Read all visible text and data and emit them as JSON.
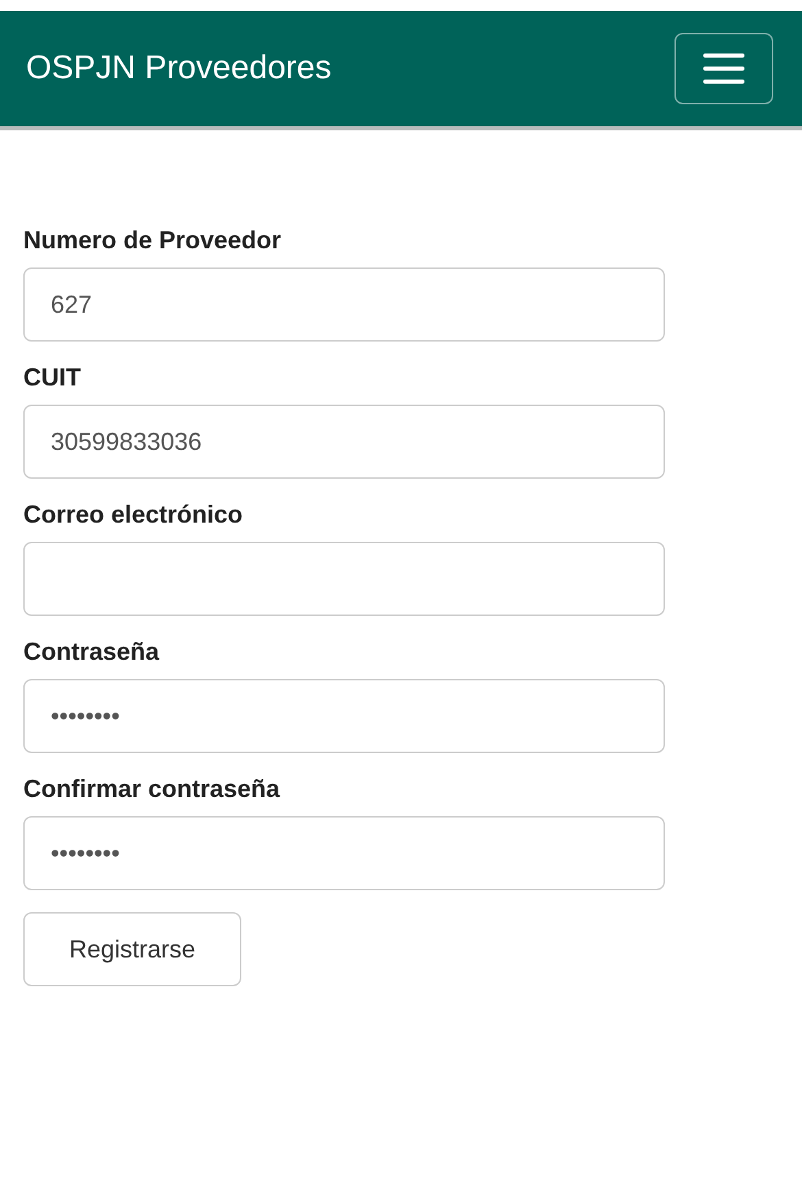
{
  "navbar": {
    "title": "OSPJN Proveedores"
  },
  "fields": [
    {
      "label": "Numero de Proveedor",
      "value": "627"
    },
    {
      "label": "CUIT",
      "value": "30599833036"
    },
    {
      "label": "Correo electrónico"
    },
    {
      "label": "Contraseña",
      "value": "••••••••"
    },
    {
      "label": "Confirmar contraseña",
      "value": "••••••••"
    }
  ],
  "submit": {
    "label": "Registrarse"
  }
}
